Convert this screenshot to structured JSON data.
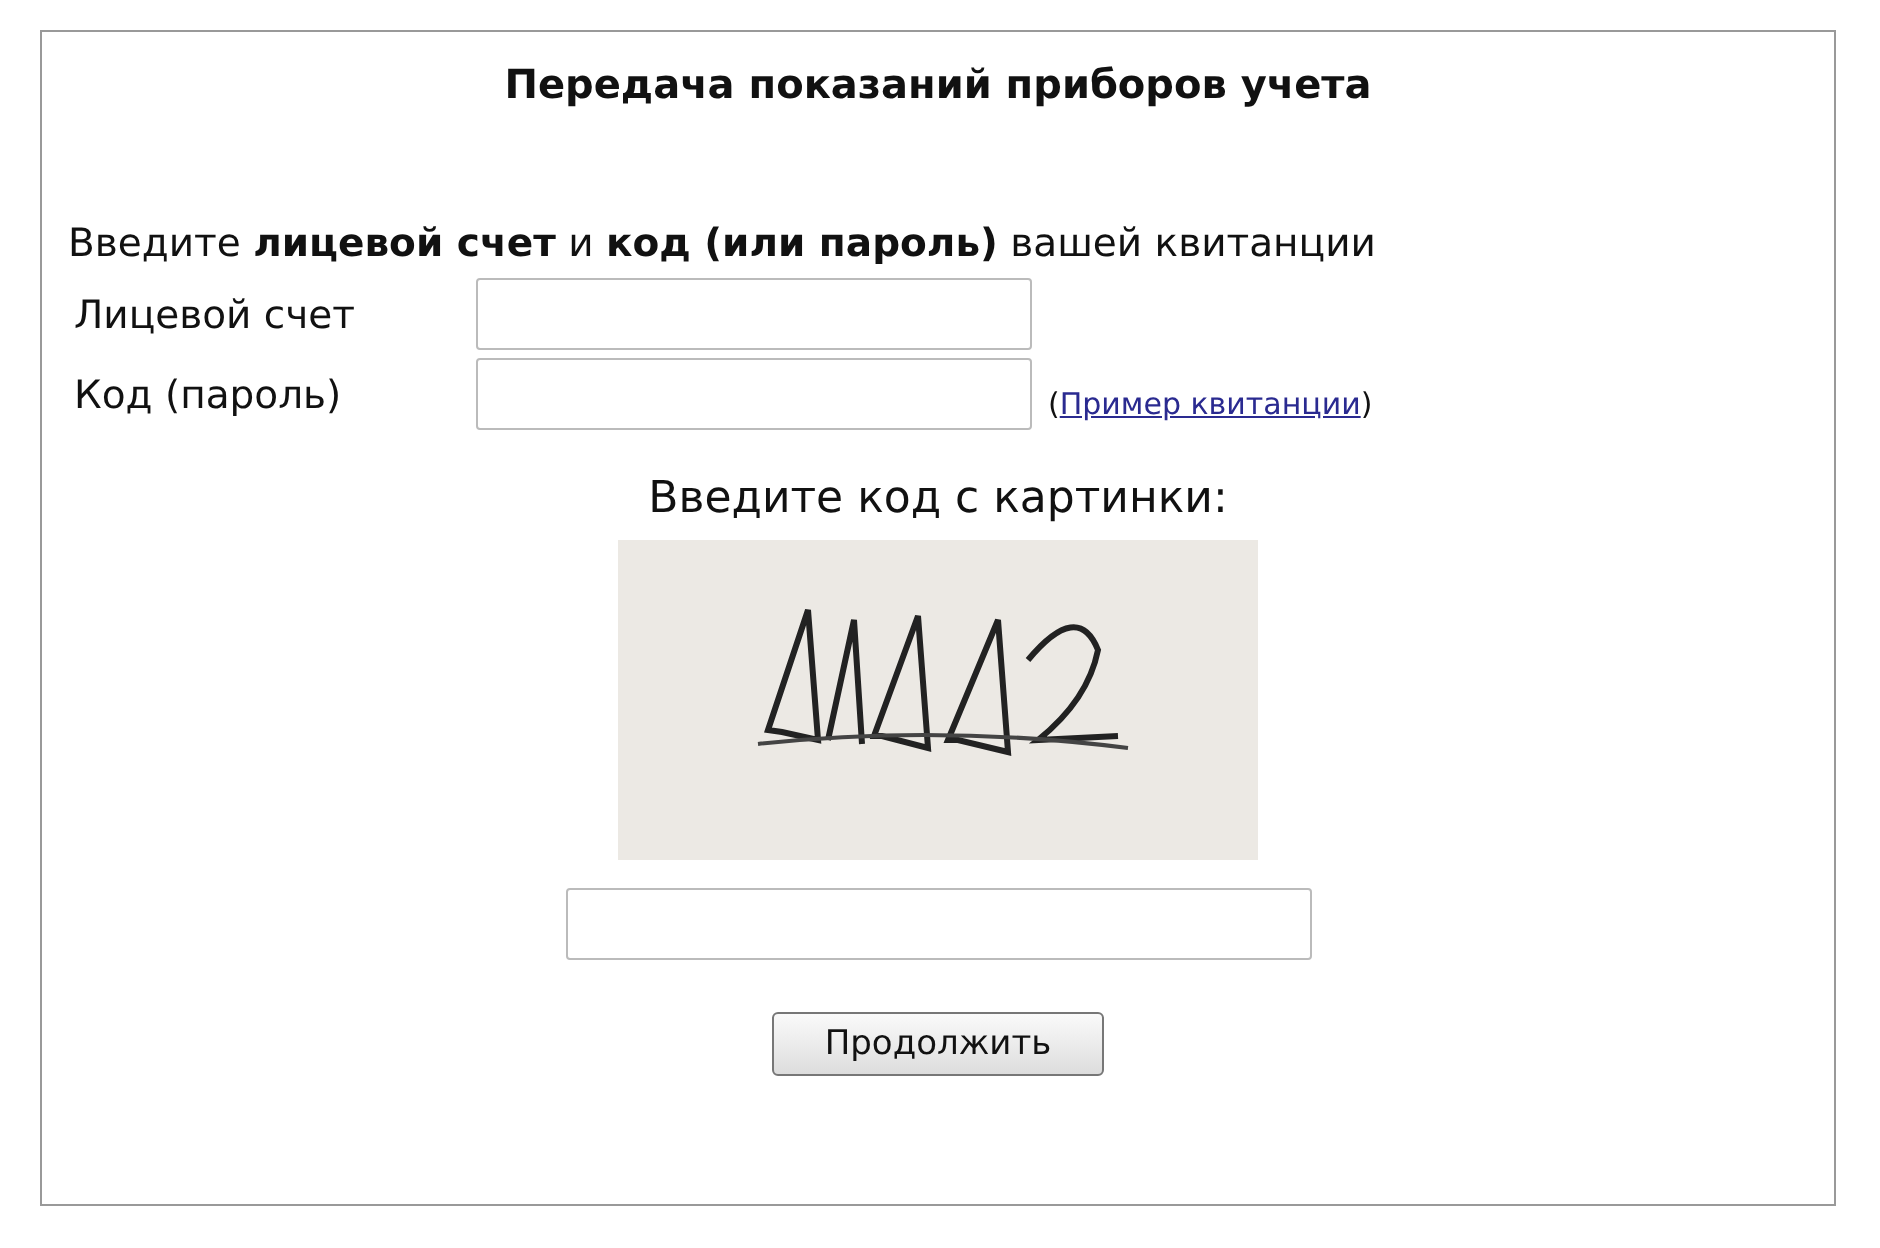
{
  "title": "Передача показаний приборов учета",
  "instruction": "Введите **лицевой счет** и **код (или пароль)** вашей квитанции",
  "fields": [
    {
      "label": "Лицевой счет"
    },
    {
      "label": "Код (пароль)",
      "link": {
        "open": "(",
        "label": "Пример квитанции",
        "close": ")"
      }
    }
  ],
  "captcha": {
    "label": "Введите код с картинки:",
    "kind": "picture"
  },
  "button": "Продолжить"
}
